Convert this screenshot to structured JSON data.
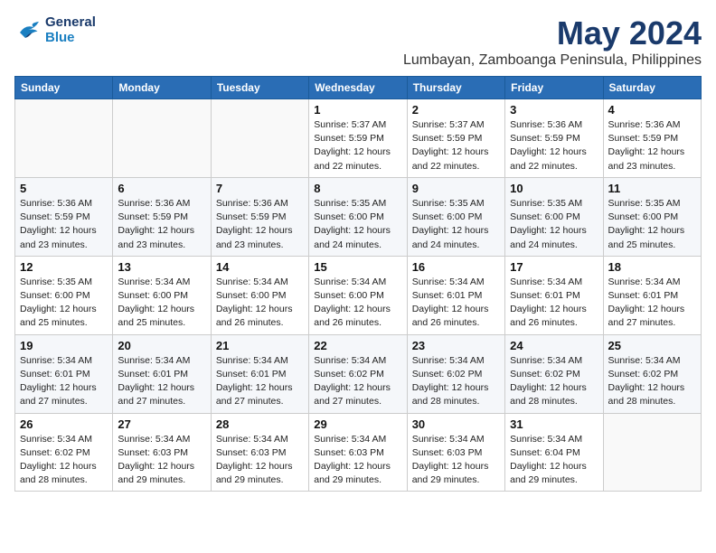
{
  "logo": {
    "line1": "General",
    "line2": "Blue"
  },
  "title": "May 2024",
  "location": "Lumbayan, Zamboanga Peninsula, Philippines",
  "weekdays": [
    "Sunday",
    "Monday",
    "Tuesday",
    "Wednesday",
    "Thursday",
    "Friday",
    "Saturday"
  ],
  "weeks": [
    [
      {
        "day": "",
        "info": ""
      },
      {
        "day": "",
        "info": ""
      },
      {
        "day": "",
        "info": ""
      },
      {
        "day": "1",
        "info": "Sunrise: 5:37 AM\nSunset: 5:59 PM\nDaylight: 12 hours\nand 22 minutes."
      },
      {
        "day": "2",
        "info": "Sunrise: 5:37 AM\nSunset: 5:59 PM\nDaylight: 12 hours\nand 22 minutes."
      },
      {
        "day": "3",
        "info": "Sunrise: 5:36 AM\nSunset: 5:59 PM\nDaylight: 12 hours\nand 22 minutes."
      },
      {
        "day": "4",
        "info": "Sunrise: 5:36 AM\nSunset: 5:59 PM\nDaylight: 12 hours\nand 23 minutes."
      }
    ],
    [
      {
        "day": "5",
        "info": "Sunrise: 5:36 AM\nSunset: 5:59 PM\nDaylight: 12 hours\nand 23 minutes."
      },
      {
        "day": "6",
        "info": "Sunrise: 5:36 AM\nSunset: 5:59 PM\nDaylight: 12 hours\nand 23 minutes."
      },
      {
        "day": "7",
        "info": "Sunrise: 5:36 AM\nSunset: 5:59 PM\nDaylight: 12 hours\nand 23 minutes."
      },
      {
        "day": "8",
        "info": "Sunrise: 5:35 AM\nSunset: 6:00 PM\nDaylight: 12 hours\nand 24 minutes."
      },
      {
        "day": "9",
        "info": "Sunrise: 5:35 AM\nSunset: 6:00 PM\nDaylight: 12 hours\nand 24 minutes."
      },
      {
        "day": "10",
        "info": "Sunrise: 5:35 AM\nSunset: 6:00 PM\nDaylight: 12 hours\nand 24 minutes."
      },
      {
        "day": "11",
        "info": "Sunrise: 5:35 AM\nSunset: 6:00 PM\nDaylight: 12 hours\nand 25 minutes."
      }
    ],
    [
      {
        "day": "12",
        "info": "Sunrise: 5:35 AM\nSunset: 6:00 PM\nDaylight: 12 hours\nand 25 minutes."
      },
      {
        "day": "13",
        "info": "Sunrise: 5:34 AM\nSunset: 6:00 PM\nDaylight: 12 hours\nand 25 minutes."
      },
      {
        "day": "14",
        "info": "Sunrise: 5:34 AM\nSunset: 6:00 PM\nDaylight: 12 hours\nand 26 minutes."
      },
      {
        "day": "15",
        "info": "Sunrise: 5:34 AM\nSunset: 6:00 PM\nDaylight: 12 hours\nand 26 minutes."
      },
      {
        "day": "16",
        "info": "Sunrise: 5:34 AM\nSunset: 6:01 PM\nDaylight: 12 hours\nand 26 minutes."
      },
      {
        "day": "17",
        "info": "Sunrise: 5:34 AM\nSunset: 6:01 PM\nDaylight: 12 hours\nand 26 minutes."
      },
      {
        "day": "18",
        "info": "Sunrise: 5:34 AM\nSunset: 6:01 PM\nDaylight: 12 hours\nand 27 minutes."
      }
    ],
    [
      {
        "day": "19",
        "info": "Sunrise: 5:34 AM\nSunset: 6:01 PM\nDaylight: 12 hours\nand 27 minutes."
      },
      {
        "day": "20",
        "info": "Sunrise: 5:34 AM\nSunset: 6:01 PM\nDaylight: 12 hours\nand 27 minutes."
      },
      {
        "day": "21",
        "info": "Sunrise: 5:34 AM\nSunset: 6:01 PM\nDaylight: 12 hours\nand 27 minutes."
      },
      {
        "day": "22",
        "info": "Sunrise: 5:34 AM\nSunset: 6:02 PM\nDaylight: 12 hours\nand 27 minutes."
      },
      {
        "day": "23",
        "info": "Sunrise: 5:34 AM\nSunset: 6:02 PM\nDaylight: 12 hours\nand 28 minutes."
      },
      {
        "day": "24",
        "info": "Sunrise: 5:34 AM\nSunset: 6:02 PM\nDaylight: 12 hours\nand 28 minutes."
      },
      {
        "day": "25",
        "info": "Sunrise: 5:34 AM\nSunset: 6:02 PM\nDaylight: 12 hours\nand 28 minutes."
      }
    ],
    [
      {
        "day": "26",
        "info": "Sunrise: 5:34 AM\nSunset: 6:02 PM\nDaylight: 12 hours\nand 28 minutes."
      },
      {
        "day": "27",
        "info": "Sunrise: 5:34 AM\nSunset: 6:03 PM\nDaylight: 12 hours\nand 29 minutes."
      },
      {
        "day": "28",
        "info": "Sunrise: 5:34 AM\nSunset: 6:03 PM\nDaylight: 12 hours\nand 29 minutes."
      },
      {
        "day": "29",
        "info": "Sunrise: 5:34 AM\nSunset: 6:03 PM\nDaylight: 12 hours\nand 29 minutes."
      },
      {
        "day": "30",
        "info": "Sunrise: 5:34 AM\nSunset: 6:03 PM\nDaylight: 12 hours\nand 29 minutes."
      },
      {
        "day": "31",
        "info": "Sunrise: 5:34 AM\nSunset: 6:04 PM\nDaylight: 12 hours\nand 29 minutes."
      },
      {
        "day": "",
        "info": ""
      }
    ]
  ]
}
